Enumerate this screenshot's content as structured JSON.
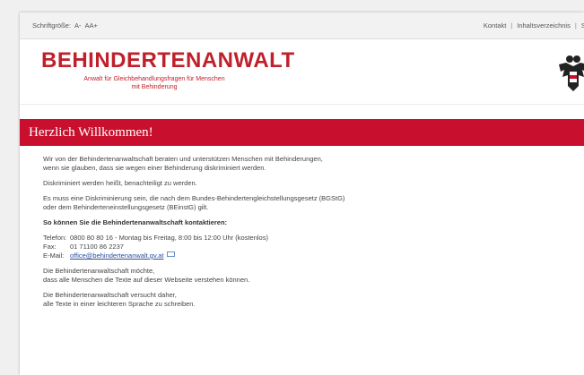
{
  "topbar": {
    "font_size_label": "Schriftgröße:",
    "font_small": "A-",
    "font_normal": "A",
    "font_large": "A+",
    "links": [
      "Kontakt",
      "Inhaltsverzeichnis",
      "Su"
    ]
  },
  "header": {
    "title": "BEHINDERTENANWALT",
    "subtitle_line1": "Anwalt für Gleichbehandlungsfragen für Menschen",
    "subtitle_line2": "mit Behinderung"
  },
  "banner": {
    "heading": "Herzlich Willkommen!"
  },
  "content": {
    "p1_line1": "Wir von der Behindertenanwaltschaft beraten und unterstützen Menschen mit Behinderungen,",
    "p1_line2": "wenn sie glauben, dass sie wegen einer Behinderung diskriminiert werden.",
    "p2": "Diskriminiert werden heißt, benachteiligt zu werden.",
    "p3_line1": "Es muss eine Diskriminierung sein, die nach dem Bundes-Behindertengleichstellungsgesetz (BGStG)",
    "p3_line2": "oder dem Behinderteneinstellungsgesetz (BEinstG) gilt.",
    "contact_heading": "So können Sie die Behindertenanwaltschaft kontaktieren:",
    "phone_label": "Telefon:",
    "phone_value": "0800 80 80 16 - Montag bis Freitag, 8:00 bis 12:00 Uhr (kostenlos)",
    "fax_label": "Fax:",
    "fax_value": "01 71100 86 2237",
    "email_label": "E-Mail:",
    "email_value": "office@behindertenanwalt.gv.at",
    "p4_line1": "Die Behindertenanwaltschaft möchte,",
    "p4_line2": "dass alle Menschen die Texte auf dieser Webseite verstehen können.",
    "p5_line1": "Die Behindertenanwaltschaft versucht daher,",
    "p5_line2": "alle Texte in einer leichteren Sprache zu schreiben."
  },
  "colors": {
    "accent": "#c8102e",
    "link": "#2a4e9b"
  },
  "icons": [
    "austrian-eagle-icon",
    "mail-icon"
  ]
}
